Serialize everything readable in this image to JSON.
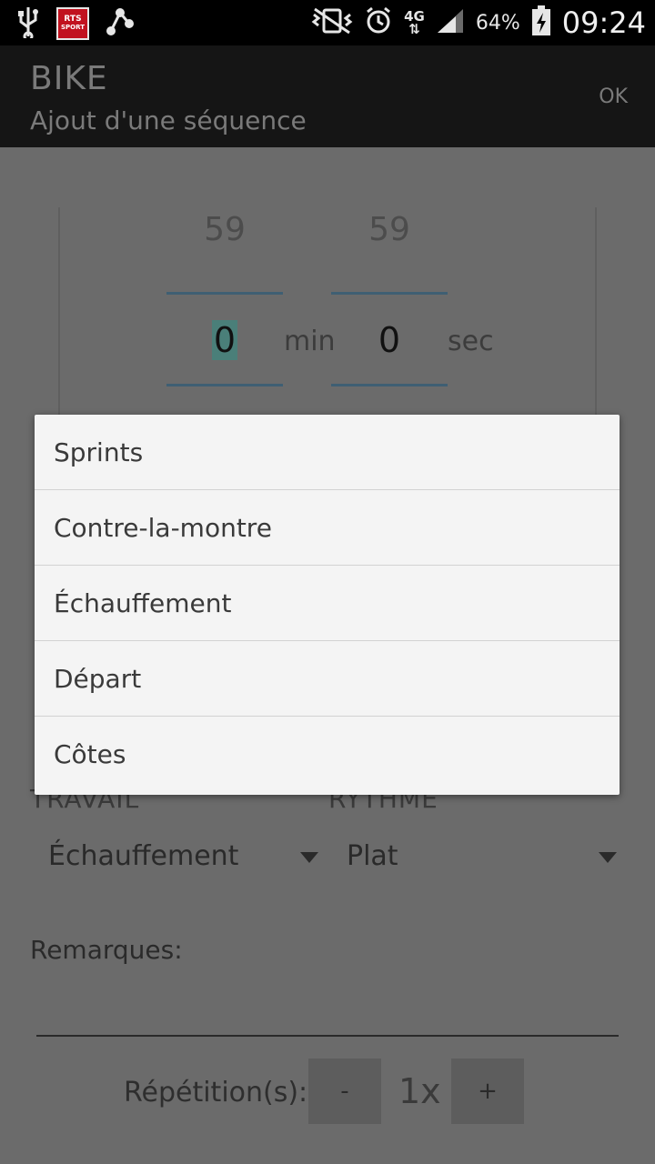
{
  "status_bar": {
    "icons": [
      "usb-icon",
      "rts-sport-icon",
      "share-icon",
      "vibrate-icon",
      "alarm-icon",
      "network-4g-icon",
      "signal-icon",
      "battery-charging-icon"
    ],
    "rts_top": "RTS",
    "rts_bottom": "SPORT",
    "network": "4G",
    "battery": "64%",
    "time": "09:24"
  },
  "action_bar": {
    "title": "BIKE",
    "subtitle": "Ajout d'une séquence",
    "ok": "OK"
  },
  "time_picker": {
    "minutes_prev": "59",
    "minutes_value": "0",
    "minutes_unit": "min",
    "seconds_prev": "59",
    "seconds_value": "0",
    "seconds_unit": "sec"
  },
  "form": {
    "travail_label": "TRAVAIL",
    "travail_value": "Échauffement",
    "rythme_label": "RYTHME",
    "rythme_value": "Plat",
    "remarks_label": "Remarques:",
    "repetition_label": "Répétition(s):",
    "minus": "-",
    "count": "1x",
    "plus": "+"
  },
  "dropdown": {
    "items": [
      "Sprints",
      "Contre-la-montre",
      "Échauffement",
      "Départ",
      "Côtes"
    ]
  },
  "colors": {
    "accent_line": "#3f5f73",
    "highlight": "#4a7f79",
    "overlay": "#6b6b6b",
    "rts_red": "#c1121f"
  }
}
